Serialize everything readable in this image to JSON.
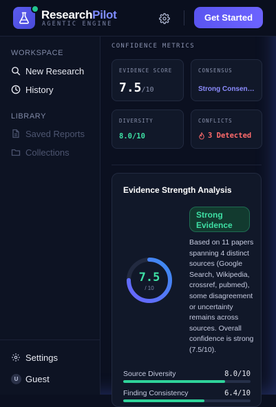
{
  "header": {
    "brand_primary": "Research",
    "brand_accent": "Pilot",
    "tagline": "AGENTIC ENGINE",
    "cta_label": "Get Started"
  },
  "sidebar": {
    "workspace_label": "WORKSPACE",
    "items": [
      {
        "label": "New Research",
        "icon": "search-icon"
      },
      {
        "label": "History",
        "icon": "clock-icon"
      }
    ],
    "library_label": "LIBRARY",
    "library_items": [
      {
        "label": "Saved Reports",
        "icon": "document-icon"
      },
      {
        "label": "Collections",
        "icon": "folder-icon"
      }
    ],
    "settings_label": "Settings",
    "user_initial": "U",
    "user_name": "Guest"
  },
  "metrics": {
    "section_label": "CONFIDENCE METRICS",
    "evidence_score": {
      "label": "EVIDENCE SCORE",
      "value": "7.5",
      "denominator": "/10"
    },
    "consensus": {
      "label": "CONSENSUS",
      "value": "Strong Consen…"
    },
    "diversity": {
      "label": "DIVERSITY",
      "value": "8.0/10"
    },
    "conflicts": {
      "label": "CONFLICTS",
      "value": "3 Detected"
    }
  },
  "analysis": {
    "title": "Evidence Strength Analysis",
    "badge": "Strong Evidence",
    "description": "Based on 11 papers spanning 4 distinct sources (Google Search, Wikipedia, crossref, pubmed), some disagreement or uncertainty remains across sources. Overall confidence is strong (7.5/10).",
    "score": "7.5",
    "score_fraction": 0.75,
    "score_den": "/ 10",
    "bars": [
      {
        "label": "Source Diversity",
        "value": "8.0/10",
        "fraction": 0.8
      },
      {
        "label": "Finding Consistency",
        "value": "6.4/10",
        "fraction": 0.64
      }
    ]
  },
  "colors": {
    "accent": "#6c63ff",
    "success": "#3ee0a4",
    "conflict": "#ff6b6b",
    "consensus": "#8c8cff"
  }
}
